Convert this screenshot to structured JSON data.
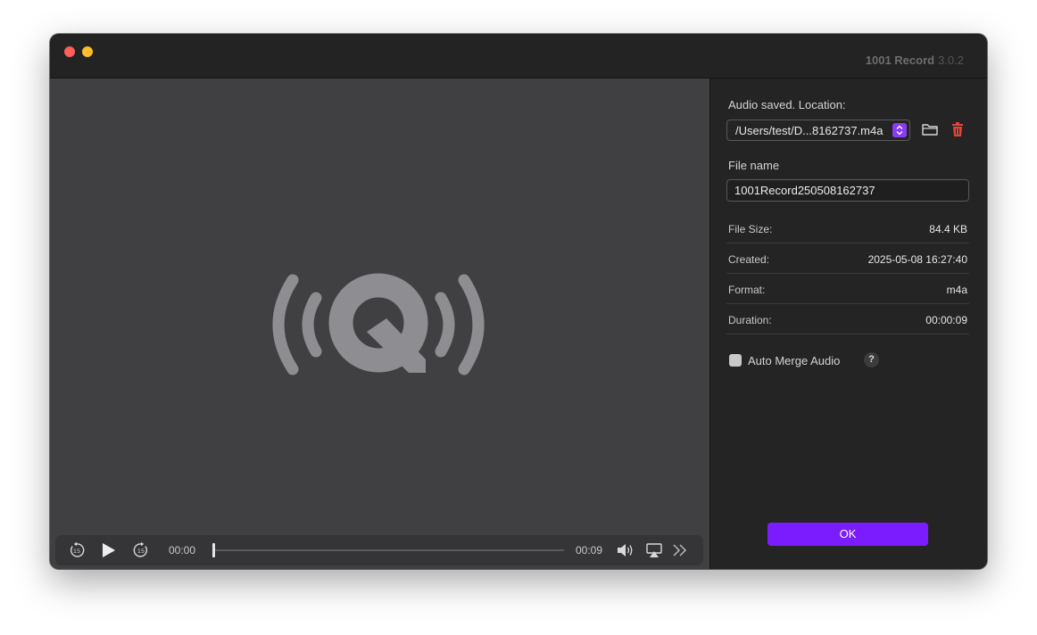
{
  "window": {
    "app_name": "1001 Record",
    "version": "3.0.2"
  },
  "player": {
    "current_time": "00:00",
    "duration": "00:09",
    "progress_fraction": 0.0,
    "icons": [
      "rewind-15-icon",
      "play-icon",
      "forward-15-icon",
      "volume-icon",
      "airplay-icon",
      "more-icon"
    ],
    "skip_seconds": "15"
  },
  "sidebar": {
    "location_label": "Audio saved. Location:",
    "location_value": "/Users/test/D...8162737.m4a",
    "file_name_label": "File name",
    "file_name_value": "1001Record250508162737",
    "info": [
      {
        "key": "File Size:",
        "value": "84.4 KB"
      },
      {
        "key": "Created:",
        "value": "2025-05-08 16:27:40"
      },
      {
        "key": "Format:",
        "value": "m4a"
      },
      {
        "key": "Duration:",
        "value": "00:00:09"
      }
    ],
    "auto_merge_label": "Auto Merge Audio",
    "auto_merge_checked": false,
    "help_symbol": "?",
    "ok_label": "OK"
  },
  "colors": {
    "accent": "#7b1cff",
    "delete": "#e0443a",
    "close": "#fe5f57",
    "minimize": "#febc2e"
  }
}
